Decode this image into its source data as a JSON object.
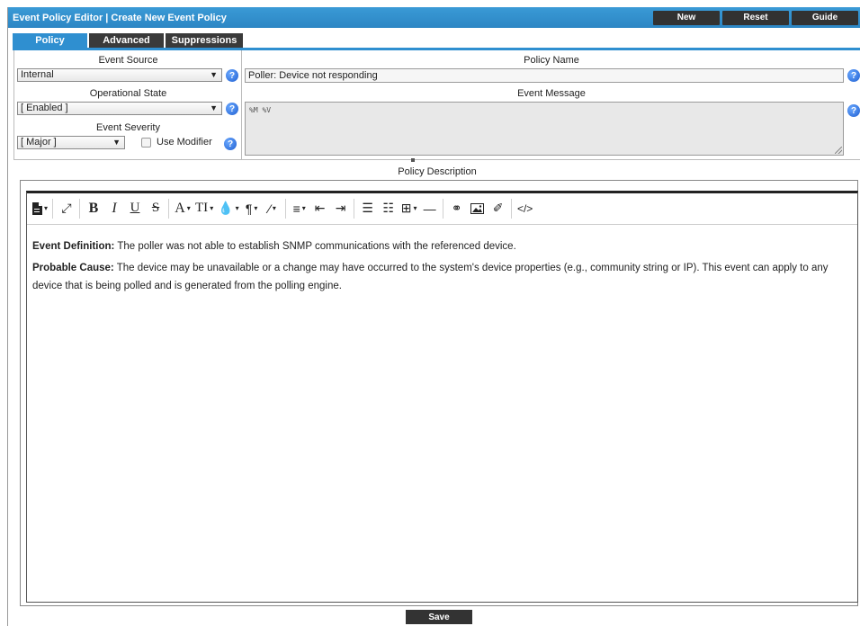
{
  "header": {
    "title": "Event Policy Editor | Create New Event Policy",
    "buttons": [
      "New",
      "Reset",
      "Guide"
    ]
  },
  "tabs": [
    {
      "label": "Policy",
      "active": true
    },
    {
      "label": "Advanced",
      "active": false
    },
    {
      "label": "Suppressions",
      "active": false
    }
  ],
  "form": {
    "event_source_label": "Event Source",
    "event_source_value": "Internal",
    "operational_state_label": "Operational State",
    "operational_state_value": "[ Enabled ]",
    "event_severity_label": "Event Severity",
    "event_severity_value": "[ Major ]",
    "use_modifier_label": "Use Modifier",
    "policy_name_label": "Policy Name",
    "policy_name_value": "Poller: Device not responding",
    "event_message_label": "Event Message",
    "event_message_value": "%M %V"
  },
  "description": {
    "label": "Policy Description",
    "toolbar_icons": [
      "file-icon",
      "fullscreen-icon",
      "bold-icon",
      "italic-icon",
      "underline-icon",
      "strikethrough-icon",
      "font-color-icon",
      "font-size-icon",
      "highlight-icon",
      "paragraph-icon",
      "magic-wand-icon",
      "align-icon",
      "outdent-icon",
      "indent-icon",
      "ordered-list-icon",
      "unordered-list-icon",
      "table-icon",
      "horizontal-rule-icon",
      "link-icon",
      "image-icon",
      "eraser-icon",
      "code-view-icon"
    ],
    "p1_bold": "Event Definition:",
    "p1_text": " The poller was not able to establish SNMP communications with the referenced device.",
    "p2_bold": "Probable Cause:",
    "p2_text": " The device may be unavailable or a change may have occurred to the system's device properties (e.g., community string or IP). This event can apply to any device that is being polled and is generated from the polling engine."
  },
  "footer": {
    "save_label": "Save"
  },
  "colors": {
    "title_bar": "#2c86c4",
    "active_tab": "#2f8fd0",
    "dark_button": "#323232",
    "help_icon": "#1f5fd0"
  }
}
